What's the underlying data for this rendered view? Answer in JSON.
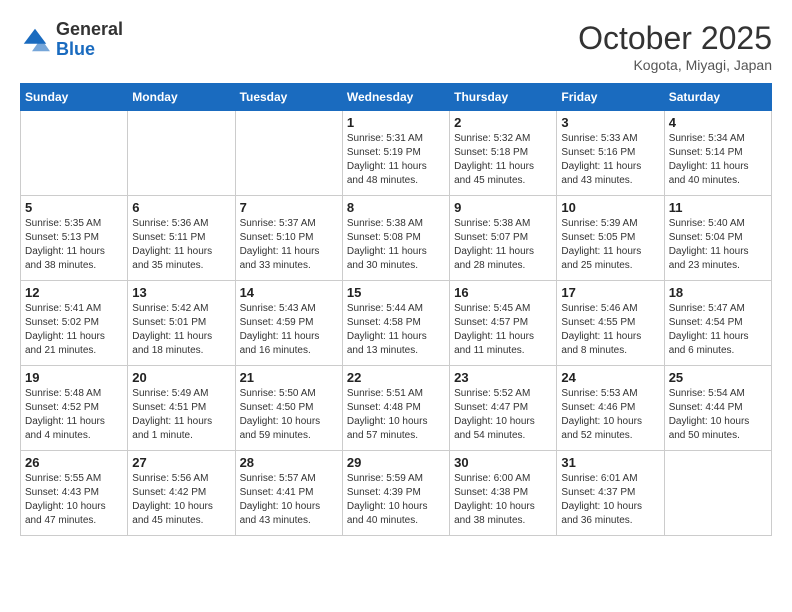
{
  "header": {
    "logo_general": "General",
    "logo_blue": "Blue",
    "month": "October 2025",
    "location": "Kogota, Miyagi, Japan"
  },
  "days_of_week": [
    "Sunday",
    "Monday",
    "Tuesday",
    "Wednesday",
    "Thursday",
    "Friday",
    "Saturday"
  ],
  "weeks": [
    [
      {
        "day": "",
        "info": ""
      },
      {
        "day": "",
        "info": ""
      },
      {
        "day": "",
        "info": ""
      },
      {
        "day": "1",
        "info": "Sunrise: 5:31 AM\nSunset: 5:19 PM\nDaylight: 11 hours\nand 48 minutes."
      },
      {
        "day": "2",
        "info": "Sunrise: 5:32 AM\nSunset: 5:18 PM\nDaylight: 11 hours\nand 45 minutes."
      },
      {
        "day": "3",
        "info": "Sunrise: 5:33 AM\nSunset: 5:16 PM\nDaylight: 11 hours\nand 43 minutes."
      },
      {
        "day": "4",
        "info": "Sunrise: 5:34 AM\nSunset: 5:14 PM\nDaylight: 11 hours\nand 40 minutes."
      }
    ],
    [
      {
        "day": "5",
        "info": "Sunrise: 5:35 AM\nSunset: 5:13 PM\nDaylight: 11 hours\nand 38 minutes."
      },
      {
        "day": "6",
        "info": "Sunrise: 5:36 AM\nSunset: 5:11 PM\nDaylight: 11 hours\nand 35 minutes."
      },
      {
        "day": "7",
        "info": "Sunrise: 5:37 AM\nSunset: 5:10 PM\nDaylight: 11 hours\nand 33 minutes."
      },
      {
        "day": "8",
        "info": "Sunrise: 5:38 AM\nSunset: 5:08 PM\nDaylight: 11 hours\nand 30 minutes."
      },
      {
        "day": "9",
        "info": "Sunrise: 5:38 AM\nSunset: 5:07 PM\nDaylight: 11 hours\nand 28 minutes."
      },
      {
        "day": "10",
        "info": "Sunrise: 5:39 AM\nSunset: 5:05 PM\nDaylight: 11 hours\nand 25 minutes."
      },
      {
        "day": "11",
        "info": "Sunrise: 5:40 AM\nSunset: 5:04 PM\nDaylight: 11 hours\nand 23 minutes."
      }
    ],
    [
      {
        "day": "12",
        "info": "Sunrise: 5:41 AM\nSunset: 5:02 PM\nDaylight: 11 hours\nand 21 minutes."
      },
      {
        "day": "13",
        "info": "Sunrise: 5:42 AM\nSunset: 5:01 PM\nDaylight: 11 hours\nand 18 minutes."
      },
      {
        "day": "14",
        "info": "Sunrise: 5:43 AM\nSunset: 4:59 PM\nDaylight: 11 hours\nand 16 minutes."
      },
      {
        "day": "15",
        "info": "Sunrise: 5:44 AM\nSunset: 4:58 PM\nDaylight: 11 hours\nand 13 minutes."
      },
      {
        "day": "16",
        "info": "Sunrise: 5:45 AM\nSunset: 4:57 PM\nDaylight: 11 hours\nand 11 minutes."
      },
      {
        "day": "17",
        "info": "Sunrise: 5:46 AM\nSunset: 4:55 PM\nDaylight: 11 hours\nand 8 minutes."
      },
      {
        "day": "18",
        "info": "Sunrise: 5:47 AM\nSunset: 4:54 PM\nDaylight: 11 hours\nand 6 minutes."
      }
    ],
    [
      {
        "day": "19",
        "info": "Sunrise: 5:48 AM\nSunset: 4:52 PM\nDaylight: 11 hours\nand 4 minutes."
      },
      {
        "day": "20",
        "info": "Sunrise: 5:49 AM\nSunset: 4:51 PM\nDaylight: 11 hours\nand 1 minute."
      },
      {
        "day": "21",
        "info": "Sunrise: 5:50 AM\nSunset: 4:50 PM\nDaylight: 10 hours\nand 59 minutes."
      },
      {
        "day": "22",
        "info": "Sunrise: 5:51 AM\nSunset: 4:48 PM\nDaylight: 10 hours\nand 57 minutes."
      },
      {
        "day": "23",
        "info": "Sunrise: 5:52 AM\nSunset: 4:47 PM\nDaylight: 10 hours\nand 54 minutes."
      },
      {
        "day": "24",
        "info": "Sunrise: 5:53 AM\nSunset: 4:46 PM\nDaylight: 10 hours\nand 52 minutes."
      },
      {
        "day": "25",
        "info": "Sunrise: 5:54 AM\nSunset: 4:44 PM\nDaylight: 10 hours\nand 50 minutes."
      }
    ],
    [
      {
        "day": "26",
        "info": "Sunrise: 5:55 AM\nSunset: 4:43 PM\nDaylight: 10 hours\nand 47 minutes."
      },
      {
        "day": "27",
        "info": "Sunrise: 5:56 AM\nSunset: 4:42 PM\nDaylight: 10 hours\nand 45 minutes."
      },
      {
        "day": "28",
        "info": "Sunrise: 5:57 AM\nSunset: 4:41 PM\nDaylight: 10 hours\nand 43 minutes."
      },
      {
        "day": "29",
        "info": "Sunrise: 5:59 AM\nSunset: 4:39 PM\nDaylight: 10 hours\nand 40 minutes."
      },
      {
        "day": "30",
        "info": "Sunrise: 6:00 AM\nSunset: 4:38 PM\nDaylight: 10 hours\nand 38 minutes."
      },
      {
        "day": "31",
        "info": "Sunrise: 6:01 AM\nSunset: 4:37 PM\nDaylight: 10 hours\nand 36 minutes."
      },
      {
        "day": "",
        "info": ""
      }
    ]
  ]
}
